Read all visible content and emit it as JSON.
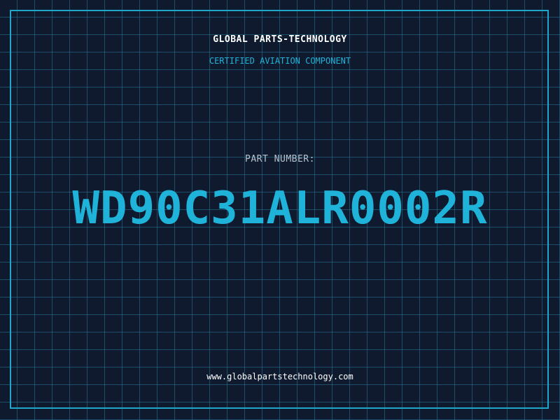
{
  "header": {
    "company": "GLOBAL PARTS-TECHNOLOGY",
    "subtitle": "CERTIFIED AVIATION COMPONENT"
  },
  "part": {
    "label": "PART NUMBER:",
    "number": "WD90C31ALR0002R"
  },
  "footer": {
    "website": "www.globalpartstechnology.com"
  },
  "colors": {
    "background": "#0f1a2e",
    "grid": "#28788f",
    "accent": "#1fb3d9",
    "frame": "#1fa6c9",
    "text_white": "#ffffff",
    "text_muted": "#b8c2cf"
  }
}
